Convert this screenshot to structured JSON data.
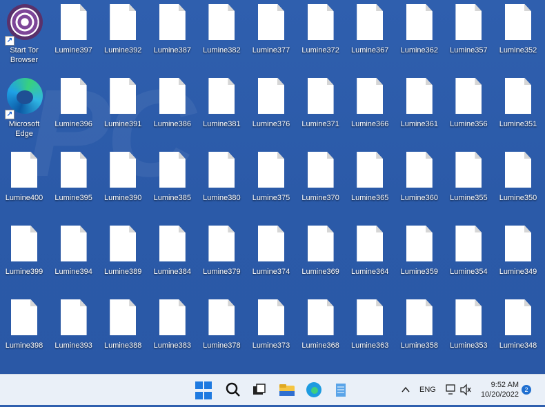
{
  "apps": [
    {
      "label": "Start Tor Browser",
      "icon": "tor-browser-icon"
    },
    {
      "label": "Microsoft Edge",
      "icon": "edge-icon"
    }
  ],
  "files": {
    "col0": [
      "Lumine400",
      "Lumine399",
      "Lumine398"
    ],
    "col1": [
      "Lumine397",
      "Lumine396",
      "Lumine395",
      "Lumine394",
      "Lumine393"
    ],
    "col2": [
      "Lumine392",
      "Lumine391",
      "Lumine390",
      "Lumine389",
      "Lumine388"
    ],
    "col3": [
      "Lumine387",
      "Lumine386",
      "Lumine385",
      "Lumine384",
      "Lumine383"
    ],
    "col4": [
      "Lumine382",
      "Lumine381",
      "Lumine380",
      "Lumine379",
      "Lumine378"
    ],
    "col5": [
      "Lumine377",
      "Lumine376",
      "Lumine375",
      "Lumine374",
      "Lumine373"
    ],
    "col6": [
      "Lumine372",
      "Lumine371",
      "Lumine370",
      "Lumine369",
      "Lumine368"
    ],
    "col7": [
      "Lumine367",
      "Lumine366",
      "Lumine365",
      "Lumine364",
      "Lumine363"
    ],
    "col8": [
      "Lumine362",
      "Lumine361",
      "Lumine360",
      "Lumine359",
      "Lumine358"
    ],
    "col9": [
      "Lumine357",
      "Lumine356",
      "Lumine355",
      "Lumine354",
      "Lumine353"
    ],
    "col10": [
      "Lumine352",
      "Lumine351",
      "Lumine350",
      "Lumine349",
      "Lumine348"
    ]
  },
  "taskbar": {
    "language": "ENG",
    "time": "9:52 AM",
    "date": "10/20/2022",
    "notification_count": "2",
    "pinned": [
      "start-button",
      "search-button",
      "task-view-button",
      "file-explorer-button",
      "edge-button",
      "notepad-button"
    ]
  },
  "colors": {
    "desktop_bg": "#2b5aa8",
    "taskbar_bg": "#eaf0f8",
    "accent": "#1f6fd0"
  }
}
